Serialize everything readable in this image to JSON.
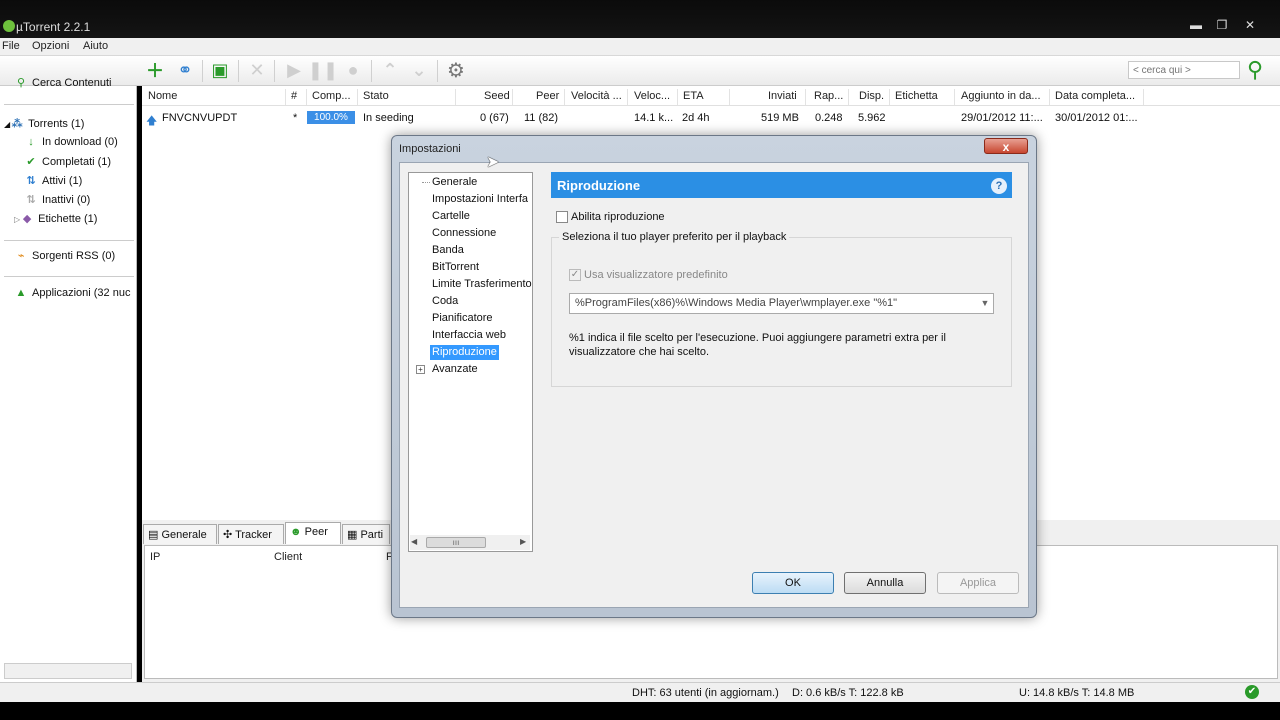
{
  "app": {
    "title": "µTorrent 2.2.1"
  },
  "menu": [
    "File",
    "Opzioni",
    "Aiuto"
  ],
  "toolbar": {
    "search_placeholder": "< cerca qui >"
  },
  "sidebar": {
    "search": "Cerca Contenuti",
    "torrents": "Torrents (1)",
    "downloading": "In download (0)",
    "completed": "Completati (1)",
    "active": "Attivi (1)",
    "inactive": "Inattivi (0)",
    "labels": "Etichette (1)",
    "rss": "Sorgenti RSS (0)",
    "apps": "Applicazioni (32 nuc"
  },
  "columns": [
    "Nome",
    "#",
    "Comp...",
    "Stato",
    "Seed",
    "Peer",
    "Velocità ...",
    "Veloc...",
    "ETA",
    "Inviati",
    "Rap...",
    "Disp.",
    "Etichetta",
    "Aggiunto in da...",
    "Data completa..."
  ],
  "torrent": {
    "name": "FNVCNVUPDT",
    "num": "*",
    "progress": "100.0%",
    "state": "In seeding",
    "seeds": "0 (67)",
    "peers": "11 (82)",
    "upspeed": "14.1 k...",
    "eta": "2d 4h",
    "uploaded": "519 MB",
    "ratio": "0.248",
    "avail": "5.962",
    "added": "29/01/2012 11:...",
    "completed": "30/01/2012 01:..."
  },
  "bottom_tabs": [
    "Generale",
    "Tracker",
    "Peer",
    "Parti"
  ],
  "peer_columns": [
    "IP",
    "Client",
    "F"
  ],
  "status": {
    "dht": "DHT: 63 utenti (in aggiornam.)",
    "down": "D: 0.6 kB/s T: 122.8 kB",
    "up": "U: 14.8 kB/s T: 14.8 MB"
  },
  "dialog": {
    "title": "Impostazioni",
    "close": "x",
    "tree": [
      "Generale",
      "Impostazioni Interfa",
      "Cartelle",
      "Connessione",
      "Banda",
      "BitTorrent",
      "Limite Trasferimento",
      "Coda",
      "Pianificatore",
      "Interfaccia web",
      "Riproduzione",
      "Avanzate"
    ],
    "pane_title": "Riproduzione",
    "help": "?",
    "enable_playback": "Abilita riproduzione",
    "group_label": "Seleziona il tuo player preferito per il playback",
    "use_default": "Usa visualizzatore predefinito",
    "player_path": "%ProgramFiles(x86)%\\Windows Media Player\\wmplayer.exe \"%1\"",
    "hint": "%1 indica il file scelto per l'esecuzione. Puoi aggiungere parametri extra per il visualizzatore che hai scelto.",
    "ok": "OK",
    "cancel": "Annulla",
    "apply": "Applica"
  }
}
